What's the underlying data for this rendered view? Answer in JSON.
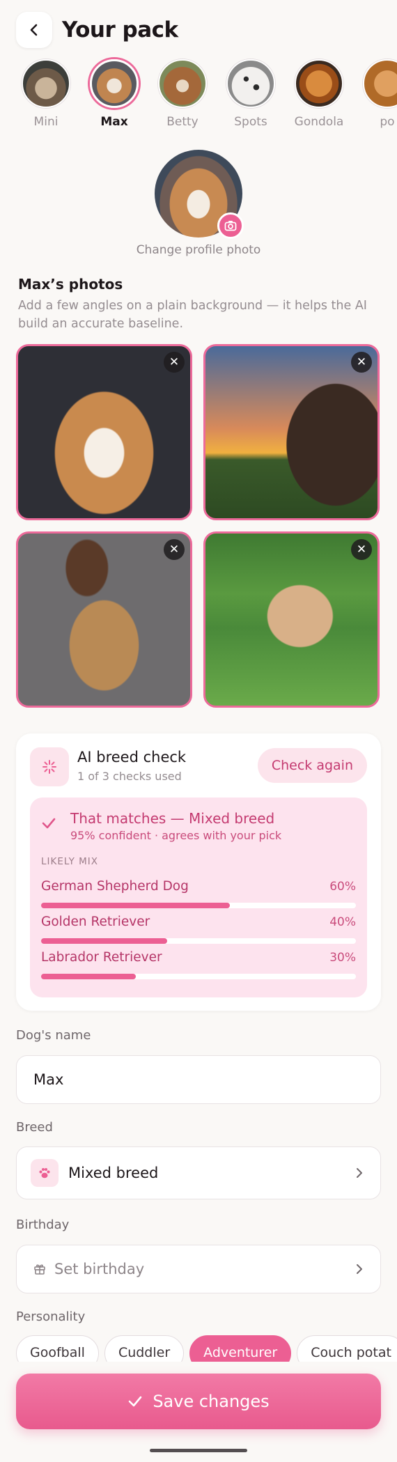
{
  "header": {
    "title": "Your pack"
  },
  "pack": [
    {
      "name": "Mini",
      "active": false,
      "color": "#8a6f55"
    },
    {
      "name": "Max",
      "active": true,
      "color": "#b07a45"
    },
    {
      "name": "Betty",
      "active": false,
      "color": "#a4683a"
    },
    {
      "name": "Spots",
      "active": false,
      "color": "#d6d4d2"
    },
    {
      "name": "Gondola",
      "active": false,
      "color": "#b3621e"
    },
    {
      "name": "po",
      "active": false,
      "color": "#c77c34"
    }
  ],
  "profile": {
    "change_label": "Change profile photo"
  },
  "photos_section": {
    "title": "Max’s photos",
    "description": "Add a few angles on a plain background — it helps the AI build an accurate baseline.",
    "remove_label": "✕"
  },
  "ai_check": {
    "title": "AI breed check",
    "usage": "1 of 3 checks used",
    "button": "Check again",
    "result_title": "That matches — Mixed breed",
    "result_sub": "95% confident · agrees with your pick",
    "likely_label": "LIKELY MIX",
    "mix": [
      {
        "breed": "German Shepherd Dog",
        "percent": "60%",
        "value": 0.6
      },
      {
        "breed": "Golden Retriever",
        "percent": "40%",
        "value": 0.4
      },
      {
        "breed": "Labrador Retriever",
        "percent": "30%",
        "value": 0.3
      }
    ]
  },
  "form": {
    "name_label": "Dog's name",
    "name_value": "Max",
    "breed_label": "Breed",
    "breed_value": "Mixed breed",
    "birthday_label": "Birthday",
    "birthday_placeholder": "Set birthday",
    "personality_label": "Personality",
    "personality": [
      {
        "label": "Goofball",
        "selected": false
      },
      {
        "label": "Cuddler",
        "selected": false
      },
      {
        "label": "Adventurer",
        "selected": true
      },
      {
        "label": "Couch potat",
        "selected": false
      }
    ]
  },
  "save": {
    "label": "Save changes"
  },
  "colors": {
    "accent": "#ec5f93",
    "accent_light": "#fce4ec",
    "background": "#faf8f6"
  }
}
